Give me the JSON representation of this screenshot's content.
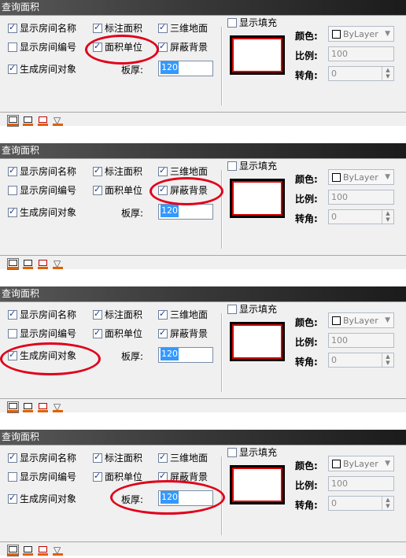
{
  "panels": [
    {
      "title": "查询面积",
      "checkboxes": {
        "show_room_name": {
          "label": "显示房间名称",
          "checked": true
        },
        "mark_area": {
          "label": "标注面积",
          "checked": true
        },
        "3d_floor": {
          "label": "三维地面",
          "checked": true
        },
        "show_room_number": {
          "label": "显示房间编号",
          "checked": false
        },
        "area_unit": {
          "label": "面积单位",
          "checked": true
        },
        "mask_background": {
          "label": "屏蔽背景",
          "checked": true
        },
        "create_room_object": {
          "label": "生成房间对象",
          "checked": true
        },
        "show_fill": {
          "label": "显示填充",
          "checked": false
        }
      },
      "thickness_label": "板厚:",
      "thickness_value": "120",
      "color_label": "颜色:",
      "color_value": "ByLayer",
      "scale_label": "比例:",
      "scale_value": "100",
      "angle_label": "转角:",
      "angle_value": "0",
      "highlight": "area_unit"
    },
    {
      "title": "查询面积",
      "checkboxes": {
        "show_room_name": {
          "label": "显示房间名称",
          "checked": true
        },
        "mark_area": {
          "label": "标注面积",
          "checked": true
        },
        "3d_floor": {
          "label": "三维地面",
          "checked": true
        },
        "show_room_number": {
          "label": "显示房间编号",
          "checked": false
        },
        "area_unit": {
          "label": "面积单位",
          "checked": true
        },
        "mask_background": {
          "label": "屏蔽背景",
          "checked": true
        },
        "create_room_object": {
          "label": "生成房间对象",
          "checked": true
        },
        "show_fill": {
          "label": "显示填充",
          "checked": false
        }
      },
      "thickness_label": "板厚:",
      "thickness_value": "120",
      "color_label": "颜色:",
      "color_value": "ByLayer",
      "scale_label": "比例:",
      "scale_value": "100",
      "angle_label": "转角:",
      "angle_value": "0",
      "highlight": "mask_background"
    },
    {
      "title": "查询面积",
      "checkboxes": {
        "show_room_name": {
          "label": "显示房间名称",
          "checked": true
        },
        "mark_area": {
          "label": "标注面积",
          "checked": true
        },
        "3d_floor": {
          "label": "三维地面",
          "checked": true
        },
        "show_room_number": {
          "label": "显示房间编号",
          "checked": false
        },
        "area_unit": {
          "label": "面积单位",
          "checked": true
        },
        "mask_background": {
          "label": "屏蔽背景",
          "checked": true
        },
        "create_room_object": {
          "label": "生成房间对象",
          "checked": true
        },
        "show_fill": {
          "label": "显示填充",
          "checked": false
        }
      },
      "thickness_label": "板厚:",
      "thickness_value": "120",
      "color_label": "颜色:",
      "color_value": "ByLayer",
      "scale_label": "比例:",
      "scale_value": "100",
      "angle_label": "转角:",
      "angle_value": "0",
      "highlight": "create_room_object"
    },
    {
      "title": "查询面积",
      "checkboxes": {
        "show_room_name": {
          "label": "显示房间名称",
          "checked": true
        },
        "mark_area": {
          "label": "标注面积",
          "checked": true
        },
        "3d_floor": {
          "label": "三维地面",
          "checked": true
        },
        "show_room_number": {
          "label": "显示房间编号",
          "checked": false
        },
        "area_unit": {
          "label": "面积单位",
          "checked": true
        },
        "mask_background": {
          "label": "屏蔽背景",
          "checked": true
        },
        "create_room_object": {
          "label": "生成房间对象",
          "checked": true
        },
        "show_fill": {
          "label": "显示填充",
          "checked": false
        }
      },
      "thickness_label": "板厚:",
      "thickness_value": "120",
      "color_label": "颜色:",
      "color_value": "ByLayer",
      "scale_label": "比例:",
      "scale_value": "100",
      "angle_label": "转角:",
      "angle_value": "0",
      "highlight": "thickness"
    }
  ],
  "colors": {
    "title_bar": "#3a3a3a",
    "panel_bg": "#f0f0f0",
    "highlight_oval": "#e0001a",
    "fill_border": "#d40000",
    "selection": "#3399ff"
  },
  "toolbar_icons": [
    "floor-plan-icon",
    "room-icon",
    "red-room-icon",
    "triangle-icon"
  ]
}
